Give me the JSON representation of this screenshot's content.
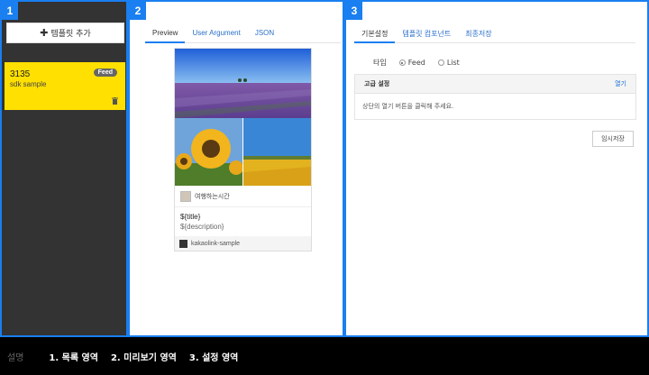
{
  "panels": {
    "list": {
      "number": "1"
    },
    "preview": {
      "number": "2"
    },
    "settings": {
      "number": "3"
    }
  },
  "list": {
    "add_button_label": "템플릿 추가",
    "add_icon": "plus-icon",
    "items": [
      {
        "title": "3135",
        "subtitle": "sdk sample",
        "badge": "Feed",
        "delete_icon": "trash-icon",
        "highlight_color": "#ffe000"
      }
    ]
  },
  "preview": {
    "tabs": [
      {
        "label": "Preview",
        "active": true
      },
      {
        "label": "User Argument",
        "active": false
      },
      {
        "label": "JSON",
        "active": false
      }
    ],
    "card": {
      "profile_name": "여행하는시간",
      "title": "${title}",
      "description": "${description}",
      "footer": "kakaolink-sample"
    }
  },
  "settings": {
    "tabs": [
      {
        "label": "기본설정",
        "active": true
      },
      {
        "label": "템플릿 컴포넌트",
        "active": false
      },
      {
        "label": "최종저장",
        "active": false
      }
    ],
    "type_label": "타입",
    "type_options": [
      {
        "label": "Feed",
        "selected": true
      },
      {
        "label": "List",
        "selected": false
      }
    ],
    "advanced": {
      "title": "고급 설정",
      "open_link": "열기",
      "hint": "상단의 열기 버튼을 클릭해 주세요."
    },
    "temp_save_label": "임시저장"
  },
  "legend": {
    "label": "설명",
    "items": [
      "1. 목록 영역",
      "2. 미리보기 영역",
      "3. 설정 영역"
    ]
  },
  "colors": {
    "accent": "#1a7ff0",
    "list_bg": "#333333",
    "card_yellow": "#ffe000"
  }
}
